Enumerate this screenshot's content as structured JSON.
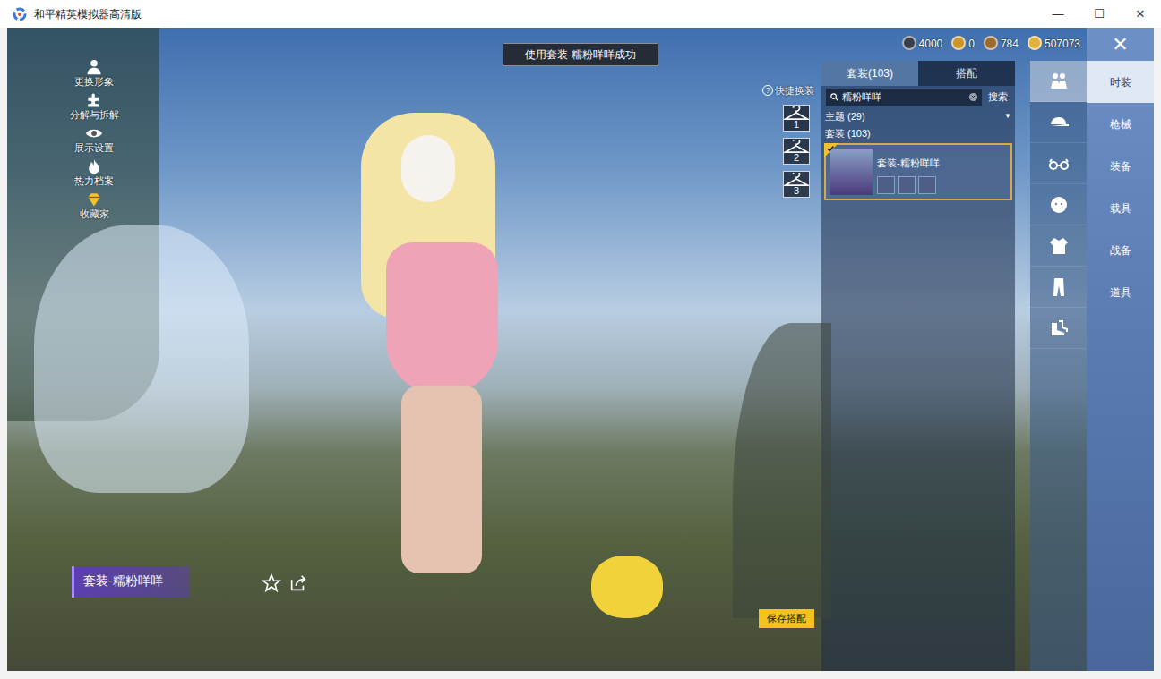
{
  "window": {
    "title": "和平精英模拟器高清版",
    "controls": [
      "—",
      "☐",
      "✕"
    ]
  },
  "toast": "使用套装-糯粉咩咩成功",
  "currencies": [
    {
      "amount": "4000",
      "color": "#3a3f4a"
    },
    {
      "amount": "0",
      "color": "#c9962a"
    },
    {
      "amount": "784",
      "color": "#9a6a2e"
    },
    {
      "amount": "507073",
      "color": "#e0b23a"
    }
  ],
  "close": "✕",
  "left_menu": [
    {
      "label": "更换形象"
    },
    {
      "label": "分解与拆解"
    },
    {
      "label": "展示设置"
    },
    {
      "label": "热力档案"
    },
    {
      "label": "收藏家"
    }
  ],
  "quick_change": {
    "label": "快捷换装",
    "help": "?",
    "slots": [
      "1",
      "2",
      "3"
    ]
  },
  "panel": {
    "tabs": [
      {
        "label": "套装(103)",
        "selected": true
      },
      {
        "label": "搭配",
        "selected": false
      }
    ],
    "search": {
      "value": "糯粉咩咩",
      "button": "搜索"
    },
    "groups": [
      {
        "label": "主题 (29)",
        "arrow": "▼"
      },
      {
        "label": "套装 (103)",
        "arrow": ""
      }
    ],
    "items": [
      {
        "name": "套装-糯粉咩咩",
        "selected": true
      }
    ]
  },
  "categories": [
    {
      "selected": true
    },
    {
      "selected": false
    },
    {
      "selected": false
    },
    {
      "selected": false
    },
    {
      "selected": false
    },
    {
      "selected": false
    },
    {
      "selected": false
    }
  ],
  "nav_tabs": [
    {
      "label": "时装",
      "selected": true
    },
    {
      "label": "枪械",
      "selected": false
    },
    {
      "label": "装备",
      "selected": false
    },
    {
      "label": "载具",
      "selected": false
    },
    {
      "label": "战备",
      "selected": false
    },
    {
      "label": "道具",
      "selected": false
    }
  ],
  "outfit_label": "套装-糯粉咩咩",
  "save_button": "保存搭配"
}
